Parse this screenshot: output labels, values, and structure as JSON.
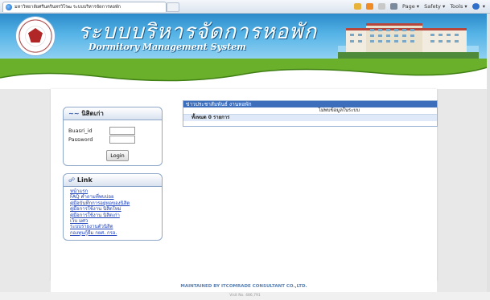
{
  "browser": {
    "tab_title": "มหาวิทยาลัยศรีนครินทรวิโรฒ ระบบบริหารจัดการหอพัก",
    "toolbar": {
      "page_label": "Page ▾",
      "safety_label": "Safety ▾",
      "tools_label": "Tools ▾",
      "help_label": "▾"
    }
  },
  "banner": {
    "thai_title": "ระบบบริหารจัดการหอพัก",
    "english_title": "Dormitory Management System"
  },
  "login_box": {
    "title": "นิสิตเก่า",
    "username_label": "Buasri_id",
    "password_label": "Password",
    "login_button": "Login"
  },
  "link_box": {
    "title": "Link",
    "items": [
      "หน้าแรก",
      "FAQ คำถามที่พบบ่อย",
      "คู่มือบันทึกการอยู่หอของนิสิต",
      "คู่มือการใช้งาน นิสิตใหม่",
      "คู่มือการใช้งาน นิสิตเก่า",
      "เว็บ มศว",
      "ระบบรายงานตัวนิสิต",
      "กองทุนกู้ยืม กยศ. กรอ."
    ]
  },
  "news": {
    "header": "ข่าวประชาสัมพันธ์ งานหอพัก",
    "empty_text": "ไม่พบข้อมูลในระบบ",
    "total_text": "ทั้งหมด 0 รายการ"
  },
  "footer": {
    "text": "MAINTAINED BY ITCOMRADE CONSULTANT CO.,LTD.",
    "visit_text": "Visit No. 486,791"
  }
}
